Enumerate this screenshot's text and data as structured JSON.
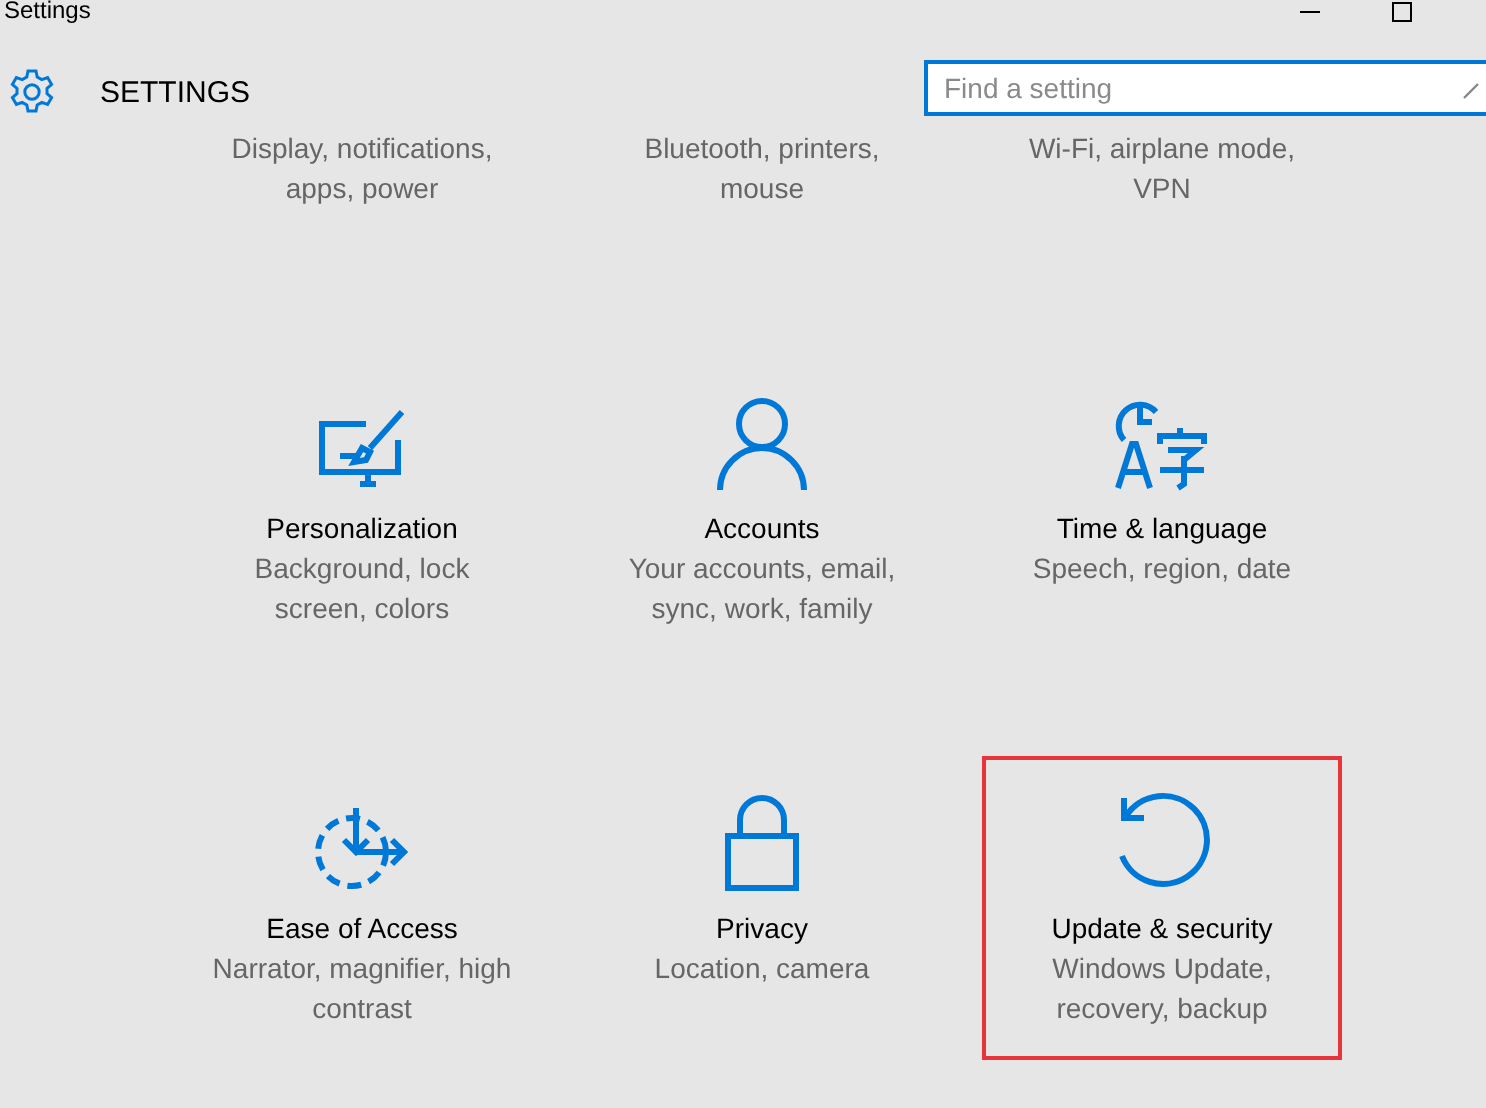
{
  "window": {
    "title": "Settings"
  },
  "header": {
    "title": "SETTINGS",
    "search": {
      "placeholder": "Find a setting"
    }
  },
  "partial_row": [
    {
      "subtitle": "Display, notifications, apps, power"
    },
    {
      "subtitle": "Bluetooth, printers, mouse"
    },
    {
      "subtitle": "Wi-Fi, airplane mode, VPN"
    }
  ],
  "tiles": [
    {
      "kind": "personalization",
      "title": "Personalization",
      "subtitle": "Background, lock screen, colors",
      "highlighted": false
    },
    {
      "kind": "accounts",
      "title": "Accounts",
      "subtitle": "Your accounts, email, sync, work, family",
      "highlighted": false
    },
    {
      "kind": "time",
      "title": "Time & language",
      "subtitle": "Speech, region, date",
      "highlighted": false
    },
    {
      "kind": "ease",
      "title": "Ease of Access",
      "subtitle": "Narrator, magnifier, high contrast",
      "highlighted": false
    },
    {
      "kind": "privacy",
      "title": "Privacy",
      "subtitle": "Location, camera",
      "highlighted": false
    },
    {
      "kind": "update",
      "title": "Update & security",
      "subtitle": "Windows Update, recovery, backup",
      "highlighted": true
    }
  ]
}
